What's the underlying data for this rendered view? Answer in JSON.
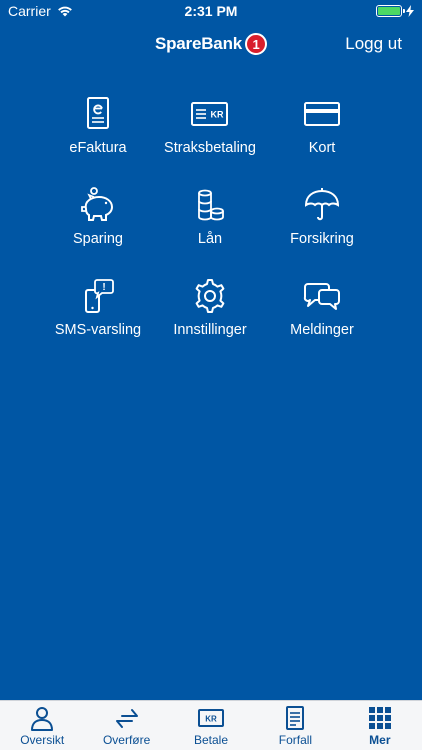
{
  "status_bar": {
    "carrier": "Carrier",
    "time": "2:31 PM"
  },
  "header": {
    "brand": "SpareBank",
    "brand_badge": "1",
    "logout_label": "Logg ut"
  },
  "menu": {
    "items": [
      {
        "label": "eFaktura",
        "icon": "efaktura-icon"
      },
      {
        "label": "Straksbetaling",
        "icon": "kr-card-icon",
        "icon_text": "KR"
      },
      {
        "label": "Kort",
        "icon": "card-icon"
      },
      {
        "label": "Sparing",
        "icon": "piggy-bank-icon"
      },
      {
        "label": "Lån",
        "icon": "coins-icon"
      },
      {
        "label": "Forsikring",
        "icon": "umbrella-icon"
      },
      {
        "label": "SMS-varsling",
        "icon": "phone-alert-icon",
        "icon_text": "!"
      },
      {
        "label": "Innstillinger",
        "icon": "gear-icon"
      },
      {
        "label": "Meldinger",
        "icon": "chat-bubbles-icon"
      }
    ]
  },
  "tabs": [
    {
      "label": "Oversikt",
      "icon": "person-icon"
    },
    {
      "label": "Overføre",
      "icon": "transfer-arrows-icon"
    },
    {
      "label": "Betale",
      "icon": "kr-icon",
      "icon_text": "KR"
    },
    {
      "label": "Forfall",
      "icon": "document-icon"
    },
    {
      "label": "Mer",
      "icon": "grid-icon",
      "active": true
    }
  ],
  "colors": {
    "background": "#0056a4",
    "tab_bar": "#f5f6f8",
    "tab_text": "#0b4f93",
    "brand_red": "#d81e2c",
    "battery": "#4cd964"
  }
}
